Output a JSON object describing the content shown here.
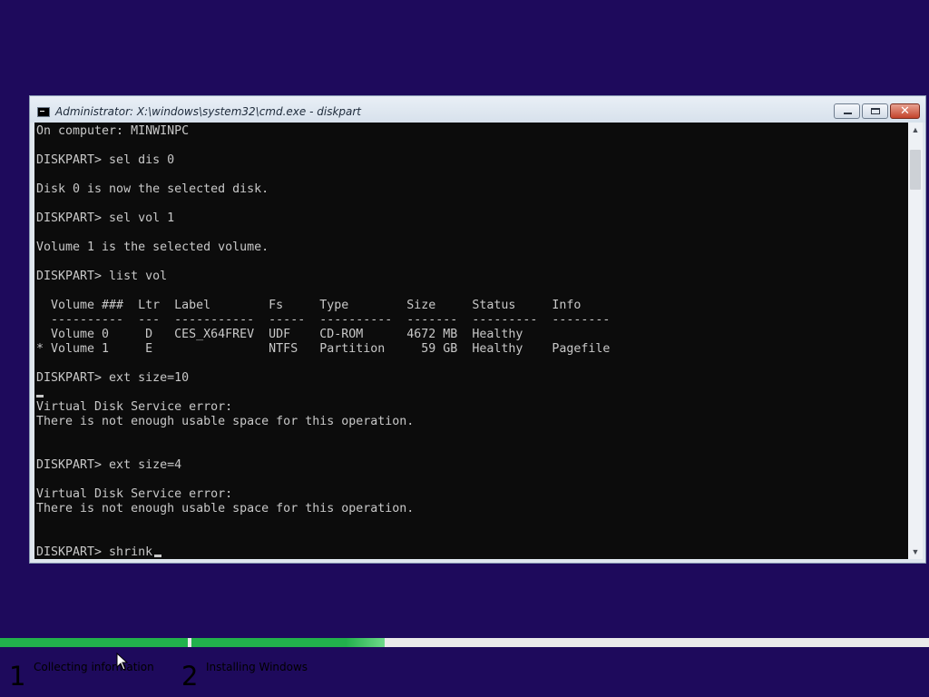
{
  "window": {
    "title": "Administrator: X:\\windows\\system32\\cmd.exe - diskpart",
    "minimize_icon": "minimize-icon",
    "maximize_icon": "maximize-icon",
    "close_label": "✕"
  },
  "console": {
    "text": "On computer: MINWINPC\n\nDISKPART> sel dis 0\n\nDisk 0 is now the selected disk.\n\nDISKPART> sel vol 1\n\nVolume 1 is the selected volume.\n\nDISKPART> list vol\n\n  Volume ###  Ltr  Label        Fs     Type        Size     Status     Info\n  ----------  ---  -----------  -----  ----------  -------  ---------  --------\n  Volume 0     D   CES_X64FREV  UDF    CD-ROM      4672 MB  Healthy\n* Volume 1     E                NTFS   Partition     59 GB  Healthy    Pagefile\n\nDISKPART> ext size=10\n\nVirtual Disk Service error:\nThere is not enough usable space for this operation.\n\n\nDISKPART> ext size=4\n\nVirtual Disk Service error:\nThere is not enough usable space for this operation.\n\n\nDISKPART> shrink"
  },
  "scrollbar": {
    "up_arrow": "▲",
    "down_arrow": "▼"
  },
  "setup": {
    "progress": [
      1.0,
      1.0
    ],
    "steps": [
      {
        "number": "1",
        "label": "Collecting information"
      },
      {
        "number": "2",
        "label": "Installing Windows"
      }
    ]
  },
  "colors": {
    "desktop": "#1e0a5c",
    "progress_fill": "#22b14c",
    "progress_track": "#eaeaea",
    "console_bg": "#0c0c0c",
    "console_fg": "#c8c8c8"
  }
}
